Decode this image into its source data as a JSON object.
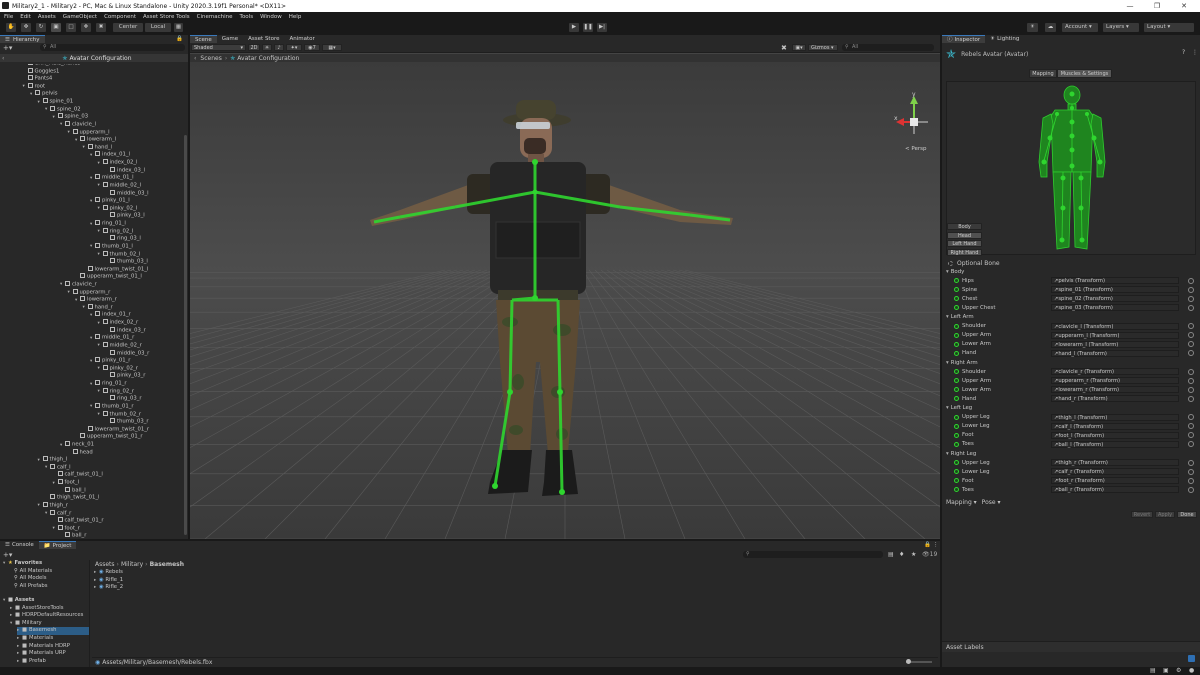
{
  "window": {
    "title": "Military2_1 - Military2 - PC, Mac & Linux Standalone - Unity 2020.3.19f1 Personal* <DX11>"
  },
  "menu": [
    "File",
    "Edit",
    "Assets",
    "GameObject",
    "Component",
    "Asset Store Tools",
    "Cinemachine",
    "Tools",
    "Window",
    "Help"
  ],
  "toolbar": {
    "center_label": "Center",
    "local_label": "Local",
    "account_label": "Account",
    "layers_label": "Layers",
    "layout_label": "Layout"
  },
  "hierarchy": {
    "tab_label": "Hierarchy",
    "search_placeholder": "All",
    "scene_label": "Avatar Configuration",
    "rows": [
      {
        "t": "CHR_Male_Hands",
        "d": 3,
        "arrow": false
      },
      {
        "t": "Goggles1",
        "d": 3,
        "arrow": false
      },
      {
        "t": "Pants4",
        "d": 3,
        "arrow": false
      },
      {
        "t": "root",
        "d": 3,
        "arrow": true
      },
      {
        "t": "pelvis",
        "d": 4,
        "arrow": true
      },
      {
        "t": "spine_01",
        "d": 5,
        "arrow": true
      },
      {
        "t": "spine_02",
        "d": 6,
        "arrow": true
      },
      {
        "t": "spine_03",
        "d": 7,
        "arrow": true
      },
      {
        "t": "clavicle_l",
        "d": 8,
        "arrow": true
      },
      {
        "t": "upperarm_l",
        "d": 9,
        "arrow": true
      },
      {
        "t": "lowerarm_l",
        "d": 10,
        "arrow": true
      },
      {
        "t": "hand_l",
        "d": 11,
        "arrow": true
      },
      {
        "t": "index_01_l",
        "d": 12,
        "arrow": true
      },
      {
        "t": "index_02_l",
        "d": 13,
        "arrow": true
      },
      {
        "t": "index_03_l",
        "d": 14,
        "arrow": false
      },
      {
        "t": "middle_01_l",
        "d": 12,
        "arrow": true
      },
      {
        "t": "middle_02_l",
        "d": 13,
        "arrow": true
      },
      {
        "t": "middle_03_l",
        "d": 14,
        "arrow": false
      },
      {
        "t": "pinky_01_l",
        "d": 12,
        "arrow": true
      },
      {
        "t": "pinky_02_l",
        "d": 13,
        "arrow": true
      },
      {
        "t": "pinky_03_l",
        "d": 14,
        "arrow": false
      },
      {
        "t": "ring_01_l",
        "d": 12,
        "arrow": true
      },
      {
        "t": "ring_02_l",
        "d": 13,
        "arrow": true
      },
      {
        "t": "ring_03_l",
        "d": 14,
        "arrow": false
      },
      {
        "t": "thumb_01_l",
        "d": 12,
        "arrow": true
      },
      {
        "t": "thumb_02_l",
        "d": 13,
        "arrow": true
      },
      {
        "t": "thumb_03_l",
        "d": 14,
        "arrow": false
      },
      {
        "t": "lowerarm_twist_01_l",
        "d": 11,
        "arrow": false
      },
      {
        "t": "upperarm_twist_01_l",
        "d": 10,
        "arrow": false
      },
      {
        "t": "clavicle_r",
        "d": 8,
        "arrow": true
      },
      {
        "t": "upperarm_r",
        "d": 9,
        "arrow": true
      },
      {
        "t": "lowerarm_r",
        "d": 10,
        "arrow": true
      },
      {
        "t": "hand_r",
        "d": 11,
        "arrow": true
      },
      {
        "t": "index_01_r",
        "d": 12,
        "arrow": true
      },
      {
        "t": "index_02_r",
        "d": 13,
        "arrow": true
      },
      {
        "t": "index_03_r",
        "d": 14,
        "arrow": false
      },
      {
        "t": "middle_01_r",
        "d": 12,
        "arrow": true
      },
      {
        "t": "middle_02_r",
        "d": 13,
        "arrow": true
      },
      {
        "t": "middle_03_r",
        "d": 14,
        "arrow": false
      },
      {
        "t": "pinky_01_r",
        "d": 12,
        "arrow": true
      },
      {
        "t": "pinky_02_r",
        "d": 13,
        "arrow": true
      },
      {
        "t": "pinky_03_r",
        "d": 14,
        "arrow": false
      },
      {
        "t": "ring_01_r",
        "d": 12,
        "arrow": true
      },
      {
        "t": "ring_02_r",
        "d": 13,
        "arrow": true
      },
      {
        "t": "ring_03_r",
        "d": 14,
        "arrow": false
      },
      {
        "t": "thumb_01_r",
        "d": 12,
        "arrow": true
      },
      {
        "t": "thumb_02_r",
        "d": 13,
        "arrow": true
      },
      {
        "t": "thumb_03_r",
        "d": 14,
        "arrow": false
      },
      {
        "t": "lowerarm_twist_01_r",
        "d": 11,
        "arrow": false
      },
      {
        "t": "upperarm_twist_01_r",
        "d": 10,
        "arrow": false
      },
      {
        "t": "neck_01",
        "d": 8,
        "arrow": true
      },
      {
        "t": "head",
        "d": 9,
        "arrow": false
      },
      {
        "t": "thigh_l",
        "d": 5,
        "arrow": true
      },
      {
        "t": "calf_l",
        "d": 6,
        "arrow": true
      },
      {
        "t": "calf_twist_01_l",
        "d": 7,
        "arrow": false
      },
      {
        "t": "foot_l",
        "d": 7,
        "arrow": true
      },
      {
        "t": "ball_l",
        "d": 8,
        "arrow": false
      },
      {
        "t": "thigh_twist_01_l",
        "d": 6,
        "arrow": false
      },
      {
        "t": "thigh_r",
        "d": 5,
        "arrow": true
      },
      {
        "t": "calf_r",
        "d": 6,
        "arrow": true
      },
      {
        "t": "calf_twist_01_r",
        "d": 7,
        "arrow": false
      },
      {
        "t": "foot_r",
        "d": 7,
        "arrow": true
      },
      {
        "t": "ball_r",
        "d": 8,
        "arrow": false
      }
    ]
  },
  "scene": {
    "tabs": [
      "Scene",
      "Game",
      "Asset Store",
      "Animator"
    ],
    "shading": "Shaded",
    "mode_2d": "2D",
    "gizmos_label": "Gizmos",
    "search_placeholder": "All",
    "breadcrumb_root": "Scenes",
    "breadcrumb_item": "Avatar Configuration",
    "persp_label": "< Persp",
    "gizmo_y": "y",
    "gizmo_x": "x"
  },
  "inspector": {
    "tabs": [
      "Inspector",
      "Lighting"
    ],
    "object_title": "Rebels Avatar (Avatar)",
    "subtabs": [
      "Mapping",
      "Muscles & Settings"
    ],
    "body_buttons": [
      "Body",
      "Head",
      "Left Hand",
      "Right Hand"
    ],
    "optional_bone": "Optional Bone",
    "groups": [
      {
        "name": "Body",
        "bones": [
          {
            "n": "Hips",
            "v": "↗pelvis (Transform)"
          },
          {
            "n": "Spine",
            "v": "↗spine_01 (Transform)"
          },
          {
            "n": "Chest",
            "v": "↗spine_02 (Transform)"
          },
          {
            "n": "Upper Chest",
            "v": "↗spine_03 (Transform)"
          }
        ]
      },
      {
        "name": "Left Arm",
        "bones": [
          {
            "n": "Shoulder",
            "v": "↗clavicle_l (Transform)"
          },
          {
            "n": "Upper Arm",
            "v": "↗upperarm_l (Transform)"
          },
          {
            "n": "Lower Arm",
            "v": "↗lowerarm_l (Transform)"
          },
          {
            "n": "Hand",
            "v": "↗hand_l (Transform)"
          }
        ]
      },
      {
        "name": "Right Arm",
        "bones": [
          {
            "n": "Shoulder",
            "v": "↗clavicle_r (Transform)"
          },
          {
            "n": "Upper Arm",
            "v": "↗upperarm_r (Transform)"
          },
          {
            "n": "Lower Arm",
            "v": "↗lowerarm_r (Transform)"
          },
          {
            "n": "Hand",
            "v": "↗hand_r (Transform)"
          }
        ]
      },
      {
        "name": "Left Leg",
        "bones": [
          {
            "n": "Upper Leg",
            "v": "↗thigh_l (Transform)"
          },
          {
            "n": "Lower Leg",
            "v": "↗calf_l (Transform)"
          },
          {
            "n": "Foot",
            "v": "↗foot_l (Transform)"
          },
          {
            "n": "Toes",
            "v": "↗ball_l (Transform)"
          }
        ]
      },
      {
        "name": "Right Leg",
        "bones": [
          {
            "n": "Upper Leg",
            "v": "↗thigh_r (Transform)"
          },
          {
            "n": "Lower Leg",
            "v": "↗calf_r (Transform)"
          },
          {
            "n": "Foot",
            "v": "↗foot_r (Transform)"
          },
          {
            "n": "Toes",
            "v": "↗ball_r (Transform)"
          }
        ]
      }
    ],
    "mapping_dropdown": "Mapping ▾",
    "pose_dropdown": "Pose ▾",
    "revert_label": "Revert",
    "apply_label": "Apply",
    "done_label": "Done",
    "asset_labels": "Asset Labels"
  },
  "bottom": {
    "tabs": [
      "Console",
      "Project"
    ],
    "favorites_label": "Favorites",
    "favorites": [
      "All Materials",
      "All Models",
      "All Prefabs"
    ],
    "assets_label": "Assets",
    "folders": [
      {
        "t": "AssetStoreTools",
        "d": 1
      },
      {
        "t": "HDRPDefaultResources",
        "d": 1
      },
      {
        "t": "Military",
        "d": 1
      },
      {
        "t": "Basemesh",
        "d": 2
      },
      {
        "t": "Materials",
        "d": 2
      },
      {
        "t": "Materials HDRP",
        "d": 2
      },
      {
        "t": "Materials URP",
        "d": 2
      },
      {
        "t": "Prefab",
        "d": 2
      }
    ],
    "breadcrumb": [
      "Assets",
      "Military",
      "Basemesh"
    ],
    "files": [
      "Rebels",
      "Rifle_1",
      "Rifle_2"
    ],
    "path": "Assets/Military/Basemesh/Rebels.fbx",
    "count_badge": "19"
  },
  "colors": {
    "accent": "#3a79bb",
    "bone_green": "#2fd62f",
    "panel": "#282828",
    "selected": "#2c5d87"
  }
}
